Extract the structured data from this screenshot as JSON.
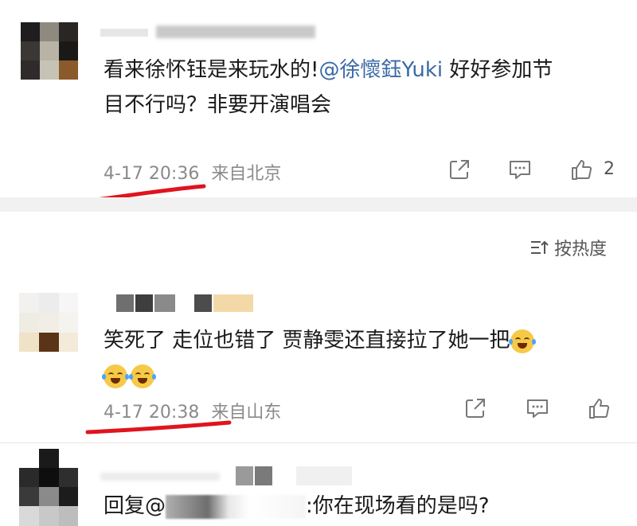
{
  "comments": [
    {
      "text_prefix": "看来徐怀钰是来玩水的!",
      "mention": "@徐懷鈺Yuki",
      "text_suffix_line1": " 好好参加节",
      "text_line2": "目不行吗？非要开演唱会",
      "time": "4-17 20:36",
      "location": "来自北京",
      "likes": "2"
    },
    {
      "text_line1": "笑死了 走位也错了 贾静雯还直接拉了她一把",
      "time": "4-17 20:38",
      "location": "来自山东"
    },
    {
      "reply_prefix": "回复@",
      "reply_text": ":你在现场看的是吗?"
    }
  ],
  "sort": {
    "label": "按热度"
  },
  "colors": {
    "mention": "#3a6aa6",
    "annotation": "#e0141e"
  }
}
